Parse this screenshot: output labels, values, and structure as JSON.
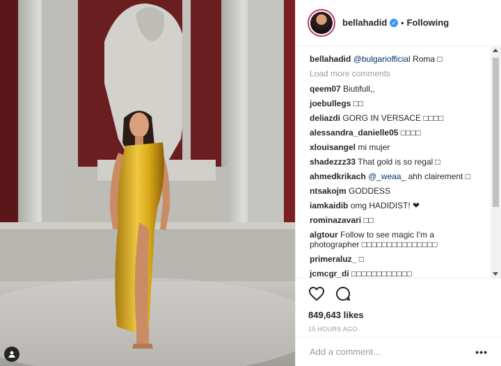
{
  "post": {
    "username": "bellahadid",
    "follow_label": "Following",
    "caption": {
      "user": "bellahadid",
      "mention": "@bulgariofficial",
      "text": " Roma □"
    },
    "load_more": "Load more comments",
    "comments": [
      {
        "user": "qeem07",
        "text": "Biutifull,,"
      },
      {
        "user": "joebullegs",
        "text": "□□"
      },
      {
        "user": "deliazdi",
        "text": "GORG IN VERSACE □□□□"
      },
      {
        "user": "alessandra_danielle05",
        "text": "□□□□"
      },
      {
        "user": "xlouisangel",
        "text": "mi mujer"
      },
      {
        "user": "shadezzz33",
        "text": "That gold is so regal □"
      },
      {
        "user": "ahmedkrikach",
        "mention": "@_weaa_",
        "text": " ahh clairement □"
      },
      {
        "user": "ntsakojm",
        "text": "GODDESS"
      },
      {
        "user": "iamkaidib",
        "text": "omg HADIDIST! ❤"
      },
      {
        "user": "rominazavari",
        "text": "□□"
      },
      {
        "user": "algtour",
        "text": "Follow to see magic I'm a photographer □□□□□□□□□□□□□□□"
      },
      {
        "user": "primeraluz_",
        "text": "□"
      },
      {
        "user": "jcmcgr_di",
        "text": "□□□□□□□□□□□□"
      }
    ],
    "likes": "849,643 likes",
    "timestamp": "15 HOURS AGO",
    "comment_placeholder": "Add a comment...",
    "more_label": "•••"
  },
  "icons": {
    "like": "heart-icon",
    "comment": "comment-icon",
    "verified": "verified-badge-icon",
    "tag": "user-tag-icon"
  },
  "colors": {
    "wall": "#6b1e20",
    "marble": "#c9c9c6",
    "dress": "#d9a818",
    "mention": "#003569",
    "verified": "#3897f0",
    "muted": "#999999"
  }
}
